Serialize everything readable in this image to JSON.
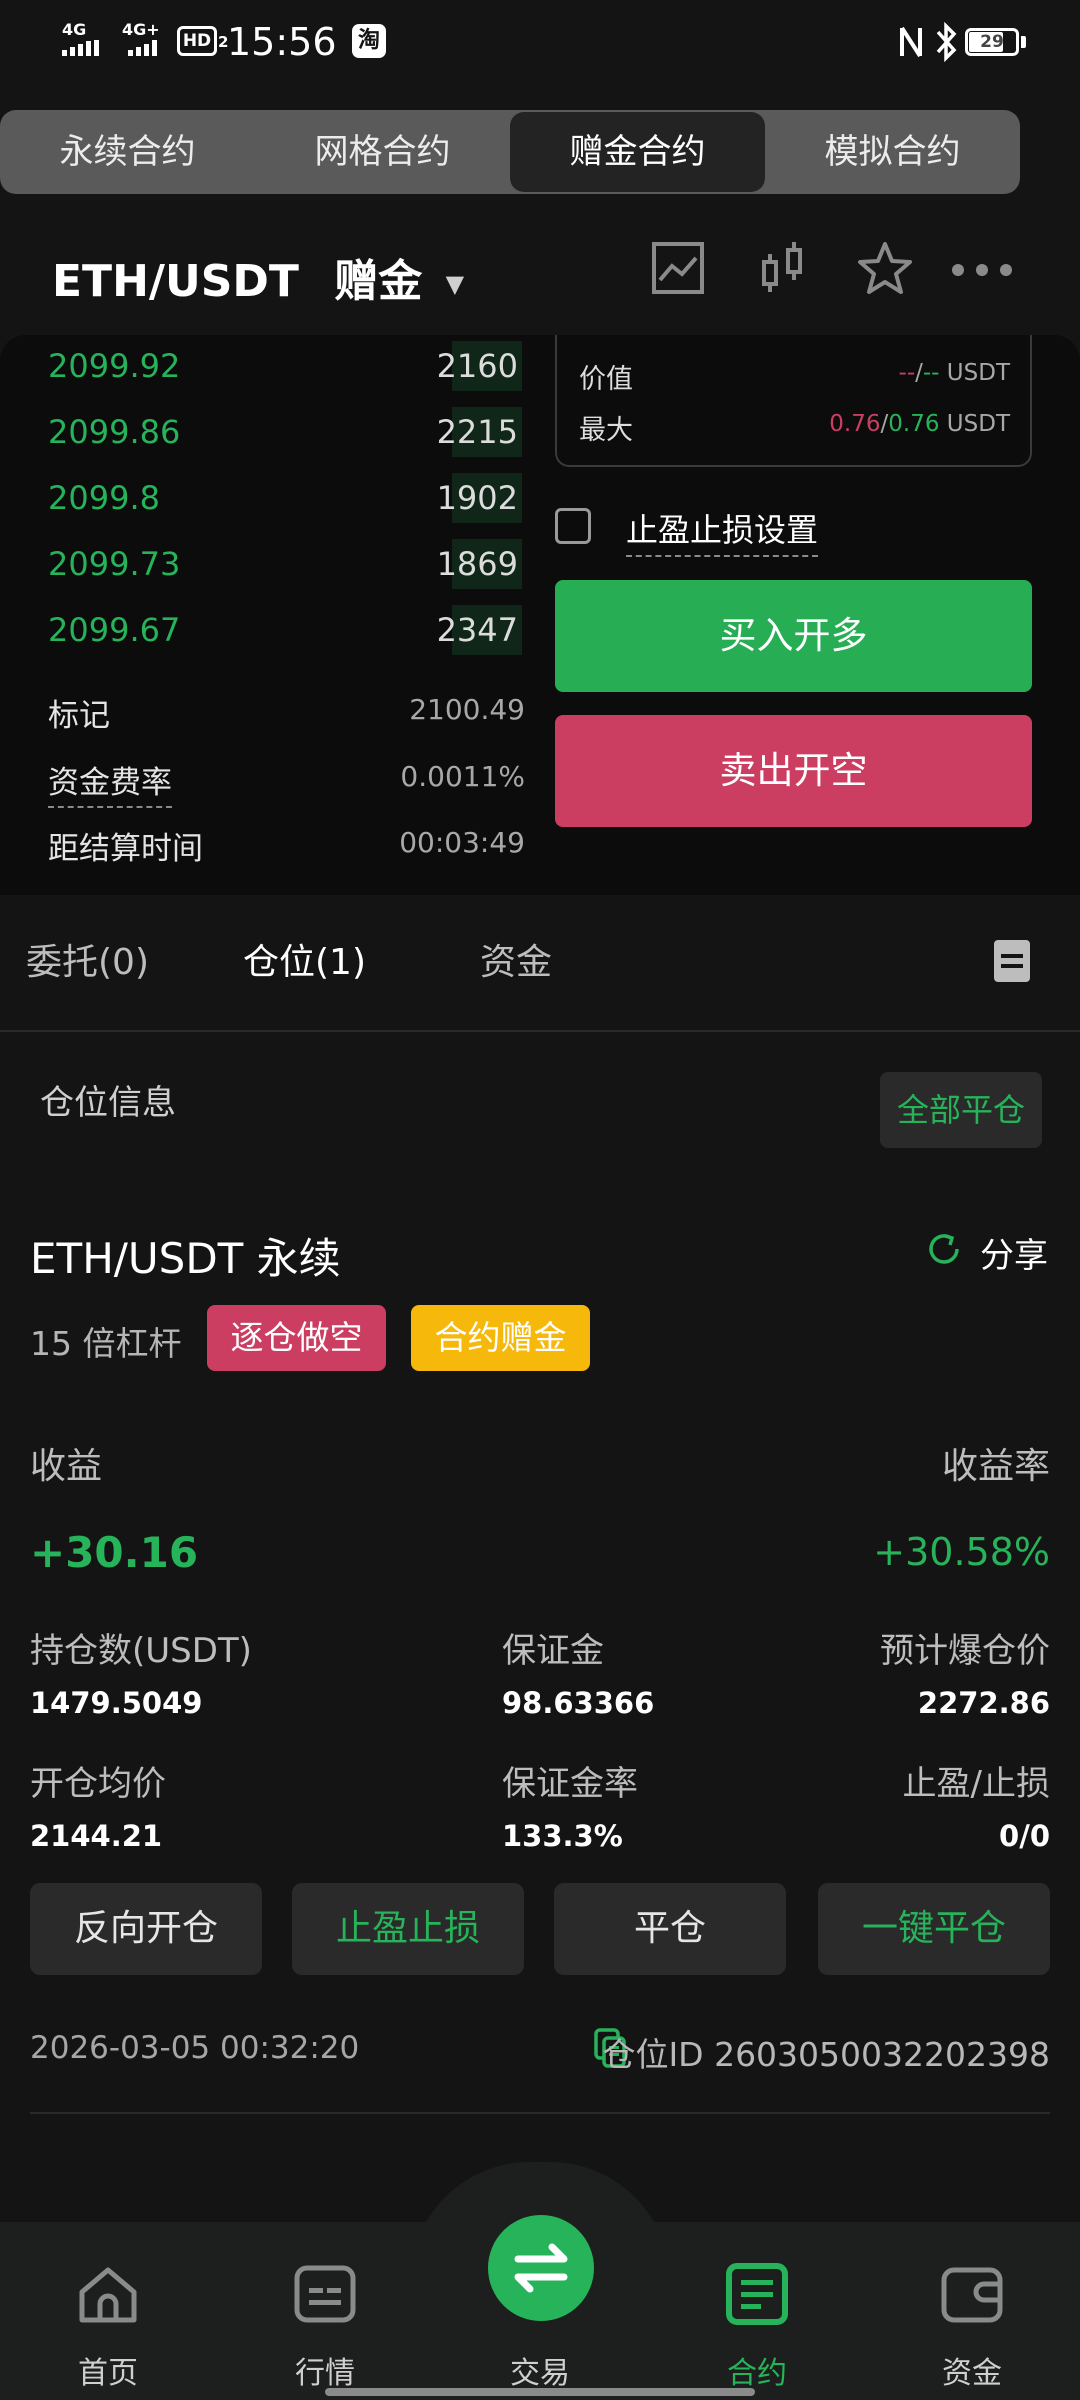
{
  "status_bar": {
    "time": "15:56",
    "signal1": "4G",
    "signal2": "4G+",
    "hd": "HD",
    "hd_sub": "2",
    "app_badge": "淘",
    "battery": "29"
  },
  "contract_tabs": [
    "永续合约",
    "网格合约",
    "赠金合约",
    "模拟合约"
  ],
  "header": {
    "pair": "ETH/USDT",
    "mode": "赠金"
  },
  "order_book": [
    {
      "price": "2099.92",
      "qty": "2160"
    },
    {
      "price": "2099.86",
      "qty": "2215"
    },
    {
      "price": "2099.8",
      "qty": "1902"
    },
    {
      "price": "2099.73",
      "qty": "1869"
    },
    {
      "price": "2099.67",
      "qty": "2347"
    }
  ],
  "market_info": {
    "mark_label": "标记",
    "mark_value": "2100.49",
    "funding_label": "资金费率",
    "funding_value": "0.0011%",
    "settle_label": "距结算时间",
    "settle_value": "00:03:49"
  },
  "value_box": {
    "value_label": "价值",
    "value_dash1": "--",
    "value_slash": "/",
    "value_dash2": "--",
    "value_unit": "USDT",
    "max_label": "最大",
    "max_sell": "0.76",
    "max_slash": "/",
    "max_buy": "0.76",
    "max_unit": "USDT"
  },
  "tp_sl_setting": "止盈止损设置",
  "buy_button": "买入开多",
  "sell_button": "卖出开空",
  "colors": {
    "green": "#27b35a",
    "red": "#cb3e62",
    "yellow": "#f5b80b"
  },
  "bottom_tabs": [
    "委托(0)",
    "仓位(1)",
    "资金"
  ],
  "position": {
    "section_title": "仓位信息",
    "close_all": "全部平仓",
    "pair": "ETH/USDT 永续",
    "share": "分享",
    "leverage": "15 倍杠杆",
    "tag_short": "逐仓做空",
    "tag_bonus": "合约赠金",
    "pnl_label": "收益",
    "pnl_value": "+30.16",
    "roe_label": "收益率",
    "roe_value": "+30.58%",
    "size_label": "持仓数(USDT)",
    "size_value": "1479.5049",
    "margin_label": "保证金",
    "margin_value": "98.63366",
    "liq_label": "预计爆仓价",
    "liq_value": "2272.86",
    "entry_label": "开仓均价",
    "entry_value": "2144.21",
    "margin_rate_label": "保证金率",
    "margin_rate_value": "133.3%",
    "tpsl_label": "止盈/止损",
    "tpsl_value": "0/0",
    "btn_reverse": "反向开仓",
    "btn_tpsl": "止盈止损",
    "btn_close": "平仓",
    "btn_close_all": "一键平仓",
    "open_time": "2026-03-05 00:32:20",
    "position_id": "仓位ID 2603050032202398"
  },
  "bottom_nav": [
    "首页",
    "行情",
    "交易",
    "合约",
    "资金"
  ]
}
